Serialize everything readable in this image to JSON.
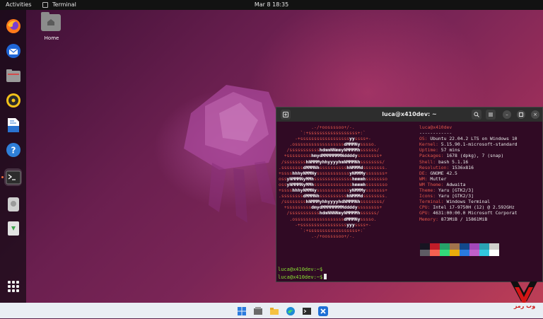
{
  "topbar": {
    "activities": "Activities",
    "app_name": "Terminal",
    "clock": "Mar 8  18:35"
  },
  "desktop": {
    "home_label": "Home"
  },
  "dock": {
    "items": [
      "firefox-icon",
      "thunderbird-icon",
      "files-icon",
      "rhythmbox-icon",
      "writer-icon",
      "help-icon",
      "terminal-icon",
      "disk-icon",
      "trash-icon",
      "app-grid-icon"
    ]
  },
  "terminal": {
    "title": "luca@x410dev: ~",
    "logo_lines": [
      "            .-/+oossssoo+/-.",
      "        `:+ssssssssssssssssss+:`",
      "      -+ssssssssssssssssssyyssss+-",
      "    .ossssssssssssssssssdMMMNysssso.",
      "   /ssssssssssshdmmNNmmyNMMMMhssssss/",
      "  +ssssssssshmydMMMMMMMNddddyssssssss+",
      " /sssssssshNMMMyhhyyyyhmNMMMNhssssssss/",
      ".ssssssssdMMMNhsssssssssshNMMMdssssssss.",
      "+sssshhhyNMMNyssssssssssssyNMMMysssssss+",
      "ossyNMMMNyMMhsssssssssssssshmmmhssssssso",
      "ossyNMMMNyMMhsssssssssssssshmmmhssssssso",
      "+sssshhhyNMMNyssssssssssssyNMMMysssssss+",
      ".ssssssssdMMMNhsssssssssshNMMMdssssssss.",
      " /sssssssshNMMMyhhyyyyhdNMMMNhssssssss/",
      "  +sssssssssdmydMMMMMMMMddddyssssssss+",
      "   /ssssssssssshdmNNNNmyNMMMMhssssss/",
      "    .ossssssssssssssssssdMMMNysssso.",
      "      -+sssssssssssssssssyyyssss+-",
      "        `:+ssssssssssssssssss+:`",
      "            .-/+oossssoo+/-."
    ],
    "info": {
      "header": "luca@x410dev",
      "separator": "------------",
      "rows": [
        {
          "key": "OS",
          "value": "Ubuntu 22.04.2 LTS on Windows 10"
        },
        {
          "key": "Kernel",
          "value": "5.15.90.1-microsoft-standard"
        },
        {
          "key": "Uptime",
          "value": "57 mins"
        },
        {
          "key": "Packages",
          "value": "1678 (dpkg), 7 (snap)"
        },
        {
          "key": "Shell",
          "value": "bash 5.1.16"
        },
        {
          "key": "Resolution",
          "value": "1536x816"
        },
        {
          "key": "DE",
          "value": "GNOME 42.5"
        },
        {
          "key": "WM",
          "value": "Mutter"
        },
        {
          "key": "WM Theme",
          "value": "Adwaita"
        },
        {
          "key": "Theme",
          "value": "Yaru [GTK2/3]"
        },
        {
          "key": "Icons",
          "value": "Yaru [GTK2/3]"
        },
        {
          "key": "Terminal",
          "value": "Windows Terminal"
        },
        {
          "key": "CPU",
          "value": "Intel i7-9750H (12) @ 2.592GHz"
        },
        {
          "key": "GPU",
          "value": "4631:00:00.0 Microsoft Corporat"
        },
        {
          "key": "Memory",
          "value": "873MiB / 15861MiB"
        }
      ]
    },
    "swatch_colors": [
      [
        "#171421",
        "#c01c28",
        "#26a269",
        "#a2734c",
        "#12488b",
        "#a347ba",
        "#2aa1b3",
        "#d0cfcc"
      ],
      [
        "#5e5c64",
        "#f66151",
        "#33da7a",
        "#e9ad0c",
        "#2a7bde",
        "#c061cb",
        "#33c7de",
        "#ffffff"
      ]
    ],
    "prompts": [
      "luca@x410dev:~$",
      "luca@x410dev:~$"
    ]
  },
  "taskbar": {
    "icons": [
      "windows-start-icon",
      "explorer-icon",
      "folder-icon",
      "edge-icon",
      "terminal-icon",
      "x410-icon"
    ]
  },
  "watermark": {
    "text": "وب رمز"
  }
}
